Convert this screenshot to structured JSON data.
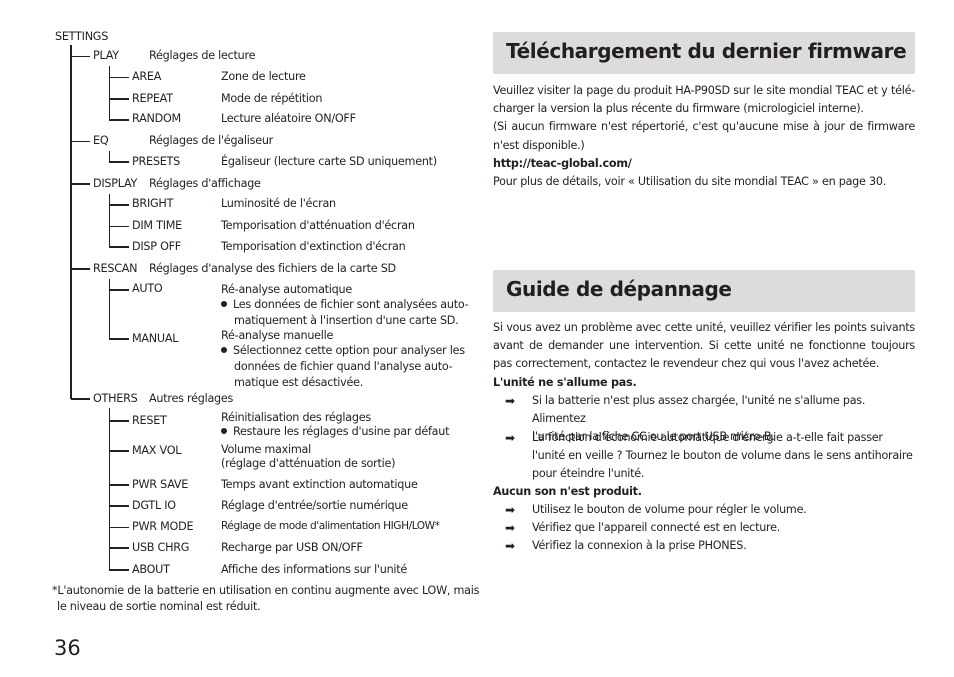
{
  "page_number": "36",
  "settings_tree": {
    "root_label": "SETTINGS",
    "groups": [
      {
        "key": "PLAY",
        "desc": "Réglages de lecture",
        "items": [
          {
            "key": "AREA",
            "desc": "Zone de lecture"
          },
          {
            "key": "REPEAT",
            "desc": "Mode de répétition"
          },
          {
            "key": "RANDOM",
            "desc": "Lecture aléatoire ON/OFF"
          }
        ]
      },
      {
        "key": "EQ",
        "desc": "Réglages de l'égaliseur",
        "items": [
          {
            "key": "PRESETS",
            "desc": "Égaliseur (lecture carte SD uniquement)"
          }
        ]
      },
      {
        "key": "DISPLAY",
        "desc": "Réglages d'affichage",
        "items": [
          {
            "key": "BRIGHT",
            "desc": "Luminosité de l'écran"
          },
          {
            "key": "DIM TIME",
            "desc": "Temporisation d'atténuation d'écran"
          },
          {
            "key": "DISP OFF",
            "desc": "Temporisation d'extinction d'écran"
          }
        ]
      },
      {
        "key": "RESCAN",
        "desc": "Réglages d'analyse des fichiers de la carte SD",
        "items": [
          {
            "key": "AUTO",
            "desc": "Ré-analyse automatique",
            "bullet": [
              "Les données de fichier sont analysées auto-",
              "matiquement à l'insertion d'une carte SD."
            ]
          },
          {
            "key": "MANUAL",
            "desc": "Ré-analyse manuelle",
            "bullet": [
              "Sélectionnez cette option pour analyser les",
              "données de fichier quand l'analyse auto-",
              "matique est désactivée."
            ]
          }
        ]
      },
      {
        "key": "OTHERS",
        "desc": "Autres réglages",
        "items": [
          {
            "key": "RESET",
            "desc": "Réinitialisation des réglages",
            "bullet": [
              "Restaure les réglages d'usine par défaut"
            ]
          },
          {
            "key": "MAX VOL",
            "desc": "Volume maximal",
            "desc2": "(réglage d'atténuation de sortie)"
          },
          {
            "key": "PWR SAVE",
            "desc": "Temps avant extinction automatique"
          },
          {
            "key": "DGTL IO",
            "desc": "Réglage d'entrée/sortie numérique"
          },
          {
            "key": "PWR MODE",
            "desc": "Réglage de mode d'alimentation HIGH/LOW*"
          },
          {
            "key": "USB CHRG",
            "desc": "Recharge par USB ON/OFF"
          },
          {
            "key": "ABOUT",
            "desc": "Affiche des informations sur l'unité"
          }
        ]
      }
    ],
    "footnote": [
      "*L'autonomie de la batterie en utilisation en continu augmente avec LOW, mais",
      "le niveau de sortie nominal est réduit."
    ]
  },
  "firmware_section": {
    "title": "Téléchargement du dernier firmware",
    "lines": [
      "Veuillez visiter la page du produit HA-P90SD sur le site mondial TEAC et y télé-",
      "charger la version la plus récente du firmware (micrologiciel interne).",
      "(Si aucun firmware n'est répertorié, c'est qu'aucune mise à jour de firmware",
      "n'est disponible.)"
    ],
    "url": "http://teac-global.com/",
    "more_info": "Pour plus de détails, voir « Utilisation du site mondial TEAC » en page 30."
  },
  "troubleshooting_section": {
    "title": "Guide de dépannage",
    "intro": [
      "Si vous avez un problème avec cette unité, veuillez vérifier les points suivants",
      "avant de demander une intervention. Si cette unité ne fonctionne toujours",
      "pas correctement, contactez le revendeur chez qui vous l'avez achetée."
    ],
    "problems": [
      {
        "heading": "L'unité ne s'allume pas.",
        "solutions": [
          [
            "Si la batterie n'est plus assez chargée, l'unité ne s'allume pas. Alimentez",
            "l'unité par la fiche CC ou le port USB micro-B."
          ],
          [
            "La fonction d'économie automatique d'énergie a-t-elle fait passer",
            "l'unité en veille ? Tournez le bouton de volume dans le sens antihoraire",
            "pour éteindre l'unité."
          ]
        ]
      },
      {
        "heading": "Aucun son n'est produit.",
        "solutions": [
          [
            "Utilisez le bouton de volume pour régler le volume."
          ],
          [
            "Vérifiez que l'appareil connecté est en lecture."
          ],
          [
            "Vérifiez la connexion à la prise PHONES."
          ]
        ]
      }
    ],
    "arrow_glyph": "➡"
  }
}
